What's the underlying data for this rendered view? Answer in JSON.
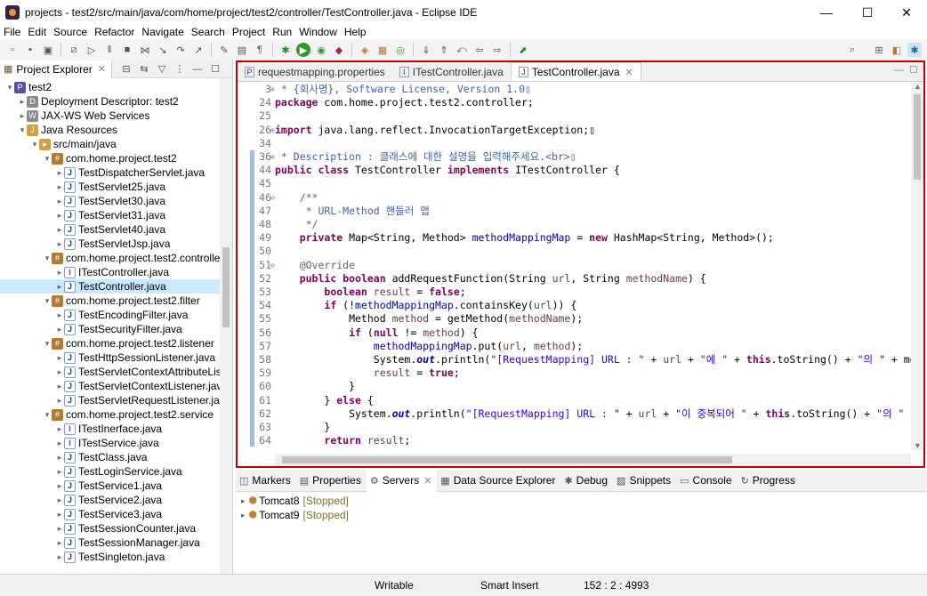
{
  "window": {
    "title": "projects - test2/src/main/java/com/home/project/test2/controller/TestController.java - Eclipse IDE",
    "minimize": "—",
    "maximize": "☐",
    "close": "✕"
  },
  "menu": [
    "File",
    "Edit",
    "Source",
    "Refactor",
    "Navigate",
    "Search",
    "Project",
    "Run",
    "Window",
    "Help"
  ],
  "left_pane": {
    "tab_label": "Project Explorer",
    "tree": [
      {
        "label": "test2",
        "depth": 0,
        "arrow": "open",
        "icon": "project-icon"
      },
      {
        "label": "Deployment Descriptor: test2",
        "depth": 1,
        "arrow": "closed",
        "icon": "descriptor-icon"
      },
      {
        "label": "JAX-WS Web Services",
        "depth": 1,
        "arrow": "closed",
        "icon": "webservice-icon"
      },
      {
        "label": "Java Resources",
        "depth": 1,
        "arrow": "open",
        "icon": "java-resources-icon"
      },
      {
        "label": "src/main/java",
        "depth": 2,
        "arrow": "open",
        "icon": "source-folder-icon"
      },
      {
        "label": "com.home.project.test2",
        "depth": 3,
        "arrow": "open",
        "icon": "package-icon"
      },
      {
        "label": "TestDispatcherServlet.java",
        "depth": 4,
        "arrow": "closed",
        "icon": "java-file-icon"
      },
      {
        "label": "TestServlet25.java",
        "depth": 4,
        "arrow": "closed",
        "icon": "java-file-icon"
      },
      {
        "label": "TestServlet30.java",
        "depth": 4,
        "arrow": "closed",
        "icon": "java-file-icon"
      },
      {
        "label": "TestServlet31.java",
        "depth": 4,
        "arrow": "closed",
        "icon": "java-file-icon"
      },
      {
        "label": "TestServlet40.java",
        "depth": 4,
        "arrow": "closed",
        "icon": "java-file-icon"
      },
      {
        "label": "TestServletJsp.java",
        "depth": 4,
        "arrow": "closed",
        "icon": "java-file-icon"
      },
      {
        "label": "com.home.project.test2.controller",
        "depth": 3,
        "arrow": "open",
        "icon": "package-icon"
      },
      {
        "label": "ITestController.java",
        "depth": 4,
        "arrow": "closed",
        "icon": "interface-file-icon"
      },
      {
        "label": "TestController.java",
        "depth": 4,
        "arrow": "closed",
        "icon": "java-file-icon",
        "selected": true
      },
      {
        "label": "com.home.project.test2.filter",
        "depth": 3,
        "arrow": "open",
        "icon": "package-icon"
      },
      {
        "label": "TestEncodingFilter.java",
        "depth": 4,
        "arrow": "closed",
        "icon": "java-file-icon"
      },
      {
        "label": "TestSecurityFilter.java",
        "depth": 4,
        "arrow": "closed",
        "icon": "java-file-icon"
      },
      {
        "label": "com.home.project.test2.listener",
        "depth": 3,
        "arrow": "open",
        "icon": "package-icon"
      },
      {
        "label": "TestHttpSessionListener.java",
        "depth": 4,
        "arrow": "closed",
        "icon": "java-file-icon"
      },
      {
        "label": "TestServletContextAttributeListe",
        "depth": 4,
        "arrow": "closed",
        "icon": "java-file-icon"
      },
      {
        "label": "TestServletContextListener.java",
        "depth": 4,
        "arrow": "closed",
        "icon": "java-file-icon"
      },
      {
        "label": "TestServletRequestListener.java",
        "depth": 4,
        "arrow": "closed",
        "icon": "java-file-icon"
      },
      {
        "label": "com.home.project.test2.service",
        "depth": 3,
        "arrow": "open",
        "icon": "package-icon"
      },
      {
        "label": "ITestInerface.java",
        "depth": 4,
        "arrow": "closed",
        "icon": "interface-file-icon"
      },
      {
        "label": "ITestService.java",
        "depth": 4,
        "arrow": "closed",
        "icon": "interface-file-icon"
      },
      {
        "label": "TestClass.java",
        "depth": 4,
        "arrow": "closed",
        "icon": "java-file-icon"
      },
      {
        "label": "TestLoginService.java",
        "depth": 4,
        "arrow": "closed",
        "icon": "java-file-icon"
      },
      {
        "label": "TestService1.java",
        "depth": 4,
        "arrow": "closed",
        "icon": "java-file-icon"
      },
      {
        "label": "TestService2.java",
        "depth": 4,
        "arrow": "closed",
        "icon": "java-file-icon"
      },
      {
        "label": "TestService3.java",
        "depth": 4,
        "arrow": "closed",
        "icon": "java-file-icon"
      },
      {
        "label": "TestSessionCounter.java",
        "depth": 4,
        "arrow": "closed",
        "icon": "java-file-icon"
      },
      {
        "label": "TestSessionManager.java",
        "depth": 4,
        "arrow": "closed",
        "icon": "java-file-icon"
      },
      {
        "label": "TestSingleton.java",
        "depth": 4,
        "arrow": "closed",
        "icon": "java-file-icon"
      }
    ]
  },
  "editor": {
    "tabs": [
      {
        "label": "requestmapping.properties",
        "icon": "properties-file-icon",
        "active": false
      },
      {
        "label": "ITestController.java",
        "icon": "interface-file-icon",
        "active": false
      },
      {
        "label": "TestController.java",
        "icon": "java-file-icon",
        "active": true
      }
    ],
    "lines": [
      {
        "n": "3",
        "fold": "⊕",
        "text": " * {회사명}, Software License, Version 1.0▯"
      },
      {
        "n": "24",
        "fold": "",
        "text": "package com.home.project.test2.controller;"
      },
      {
        "n": "25",
        "fold": "",
        "text": ""
      },
      {
        "n": "26",
        "fold": "⊕",
        "text": "import java.lang.reflect.InvocationTargetException;▯"
      },
      {
        "n": "34",
        "fold": "",
        "text": ""
      },
      {
        "n": "36",
        "fold": "⊕",
        "text": " * Description : 클래스에 대한 설명을 입력해주세요.<br>▯"
      },
      {
        "n": "44",
        "fold": "",
        "text": "public class TestController implements ITestController {"
      },
      {
        "n": "45",
        "fold": "",
        "text": ""
      },
      {
        "n": "46",
        "fold": "⊖",
        "text": "    /**"
      },
      {
        "n": "47",
        "fold": "",
        "text": "     * URL-Method 핸들러 맵"
      },
      {
        "n": "48",
        "fold": "",
        "text": "     */"
      },
      {
        "n": "49",
        "fold": "",
        "text": "    private Map<String, Method> methodMappingMap = new HashMap<String, Method>();"
      },
      {
        "n": "50",
        "fold": "",
        "text": ""
      },
      {
        "n": "51",
        "fold": "⊖",
        "text": "    @Override"
      },
      {
        "n": "52",
        "fold": "",
        "text": "    public boolean addRequestFunction(String url, String methodName) {"
      },
      {
        "n": "53",
        "fold": "",
        "text": "        boolean result = false;"
      },
      {
        "n": "54",
        "fold": "",
        "text": "        if (!methodMappingMap.containsKey(url)) {"
      },
      {
        "n": "55",
        "fold": "",
        "text": "            Method method = getMethod(methodName);"
      },
      {
        "n": "56",
        "fold": "",
        "text": "            if (null != method) {"
      },
      {
        "n": "57",
        "fold": "",
        "text": "                methodMappingMap.put(url, method);"
      },
      {
        "n": "58",
        "fold": "",
        "text": "                System.out.println(\"[RequestMapping] URL : \" + url + \"에 \" + this.toString() + \"의 \" + met"
      },
      {
        "n": "59",
        "fold": "",
        "text": "                result = true;"
      },
      {
        "n": "60",
        "fold": "",
        "text": "            }"
      },
      {
        "n": "61",
        "fold": "",
        "text": "        } else {"
      },
      {
        "n": "62",
        "fold": "",
        "text": "            System.out.println(\"[RequestMapping] URL : \" + url + \"이 중복되어 \" + this.toString() + \"의 \" +"
      },
      {
        "n": "63",
        "fold": "",
        "text": "        }"
      },
      {
        "n": "64",
        "fold": "",
        "text": "        return result;"
      }
    ]
  },
  "bottom_pane": {
    "tabs": [
      {
        "label": "Markers",
        "icon": "markers-icon"
      },
      {
        "label": "Properties",
        "icon": "properties-icon"
      },
      {
        "label": "Servers",
        "icon": "servers-icon",
        "active": true
      },
      {
        "label": "Data Source Explorer",
        "icon": "data-source-icon"
      },
      {
        "label": "Debug",
        "icon": "debug-icon"
      },
      {
        "label": "Snippets",
        "icon": "snippets-icon"
      },
      {
        "label": "Console",
        "icon": "console-icon"
      },
      {
        "label": "Progress",
        "icon": "progress-icon"
      }
    ],
    "servers": [
      {
        "name": "Tomcat8",
        "state": "[Stopped]"
      },
      {
        "name": "Tomcat9",
        "state": "[Stopped]"
      }
    ]
  },
  "status_bar": {
    "mode": "Writable",
    "insert": "Smart Insert",
    "position": "152 : 2 : 4993"
  },
  "colors": {
    "keyword": "#7f0055",
    "string": "#2a00ff",
    "comment": "#3f7f5f",
    "javadoc": "#3f5fbf",
    "field": "#0000c0",
    "annotation": "#646464",
    "highlight_border": "#c00000",
    "selection": "#cce8ff"
  }
}
